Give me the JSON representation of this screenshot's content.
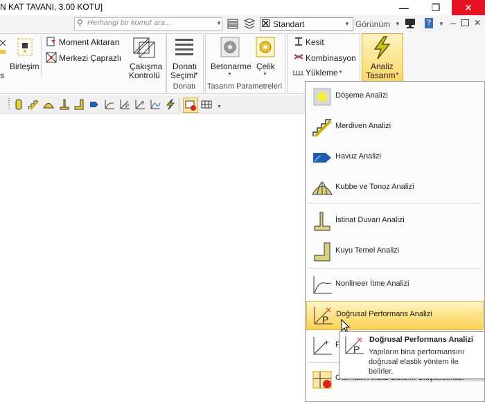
{
  "window": {
    "title": "N KAT TAVANI,  3.00 KOTU]",
    "minimize_icon": "minimize-icon",
    "restore_icon": "restore-icon",
    "close_icon": "close-icon"
  },
  "quick_access": {
    "search_placeholder": "Herhangi bir komut ara...",
    "style_value": "Standart",
    "view_label": "Görünüm"
  },
  "ribbon": {
    "partial_label": "s",
    "birlesim": "Birleşim",
    "moment_aktaran": "Moment Aktaran",
    "merkezi_caprazli": "Merkezi Çaprazlı",
    "cakisma_kontrolu_l1": "Çakışma",
    "cakisma_kontrolu_l2": "Kontrolü",
    "donati_secimi_l1": "Donatı",
    "donati_secimi_l2": "Seçimi",
    "donati_group": "Donatı",
    "betonarme": "Betonarme",
    "celik": "Çelik",
    "tasarim_group": "Tasarım Parametreleri",
    "kesit": "Kesit",
    "kombinasyon": "Kombinasyon",
    "yukleme": "Yükleme",
    "analiz_tasarim_l1": "Analiz",
    "analiz_tasarim_l2": "Tasarım"
  },
  "menu": {
    "items": [
      {
        "label": "Döşeme Analizi",
        "icon": "slab-icon"
      },
      {
        "label": "Merdiven Analizi",
        "icon": "stair-icon"
      },
      {
        "label": "Havuz Analizi",
        "icon": "pool-icon"
      },
      {
        "label": "Kubbe ve Tonoz Analizi",
        "icon": "dome-icon"
      },
      {
        "label": "İstinat Duvarı Analizi",
        "icon": "retaining-wall-icon"
      },
      {
        "label": "Kuyu Temel Analizi",
        "icon": "well-foundation-icon"
      },
      {
        "label": "Nonlineer İtme Analizi",
        "icon": "pushover-curve-icon"
      },
      {
        "label": "Doğrusal Performans Analizi",
        "icon": "linear-performance-icon"
      },
      {
        "label": "P",
        "icon": "performance-question-icon"
      },
      {
        "label": "Otomatik Analiz Sistemi Oluşturulması",
        "icon": "auto-analysis-icon"
      }
    ]
  },
  "tooltip": {
    "title": "Doğrusal Performans Analizi",
    "body_l1": "Yapıların bina performansını",
    "body_l2": "doğrusal elastik yöntem ile",
    "body_l3": "belirler."
  },
  "colors": {
    "accent_yellow": "#fcd257",
    "close_red": "#e81123",
    "icon_blue": "#1f5fae"
  }
}
